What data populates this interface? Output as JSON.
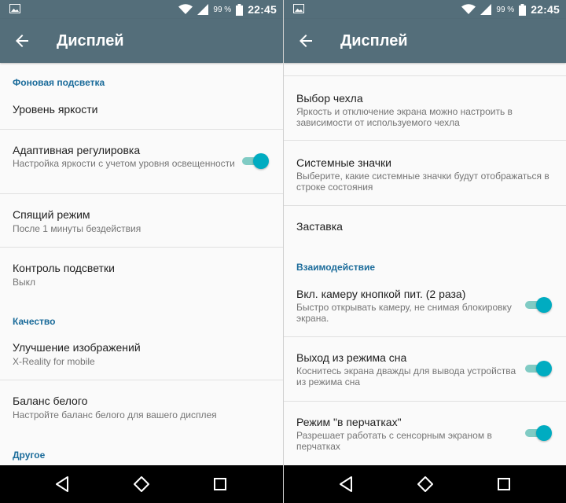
{
  "status": {
    "battery_pct": "99 %",
    "time": "22:45"
  },
  "left": {
    "title": "Дисплей",
    "sections": {
      "backlight": "Фоновая подсветка",
      "quality": "Качество",
      "other": "Другое"
    },
    "items": {
      "brightness": {
        "title": "Уровень яркости"
      },
      "adaptive": {
        "title": "Адаптивная регулировка",
        "summary": "Настройка яркости с учетом уровня освещенности",
        "on": true
      },
      "sleep": {
        "title": "Спящий режим",
        "summary": "После 1 минуты бездействия"
      },
      "backlight_ctrl": {
        "title": "Контроль подсветки",
        "summary": "Выкл"
      },
      "image": {
        "title": "Улучшение изображений",
        "summary": "X-Reality for mobile"
      },
      "white": {
        "title": "Баланс белого",
        "summary": "Настройте баланс белого для вашего дисплея"
      }
    }
  },
  "right": {
    "title": "Дисплей",
    "sections": {
      "interaction": "Взаимодействие"
    },
    "items": {
      "cover": {
        "title": "Выбор чехла",
        "summary": "Яркость и отключение экрана можно настроить в зависимости от используемого чехла"
      },
      "sysicons": {
        "title": "Системные значки",
        "summary": "Выберите, какие системные значки будут отображаться в строке состояния"
      },
      "screensaver": {
        "title": "Заставка"
      },
      "camera": {
        "title": "Вкл. камеру кнопкой пит. (2 раза)",
        "summary": "Быстро открывать камеру, не снимая блокировку экрана.",
        "on": true
      },
      "wake": {
        "title": "Выход из режима сна",
        "summary": "Коснитесь экрана дважды для вывода устройства из режима сна",
        "on": true
      },
      "gloves": {
        "title": "Режим \"в перчатках\"",
        "summary": "Разрешает работать с сенсорным экраном в перчатках",
        "on": true
      }
    }
  },
  "colors": {
    "appbar": "#546e7a",
    "section": "#1a6b9a",
    "toggle_thumb": "#00acc1",
    "toggle_track": "#80cbc4"
  },
  "icons": [
    "image-icon",
    "wifi-icon",
    "signal-icon",
    "battery-icon",
    "back-arrow-icon",
    "nav-back-icon",
    "nav-home-icon",
    "nav-recents-icon"
  ]
}
